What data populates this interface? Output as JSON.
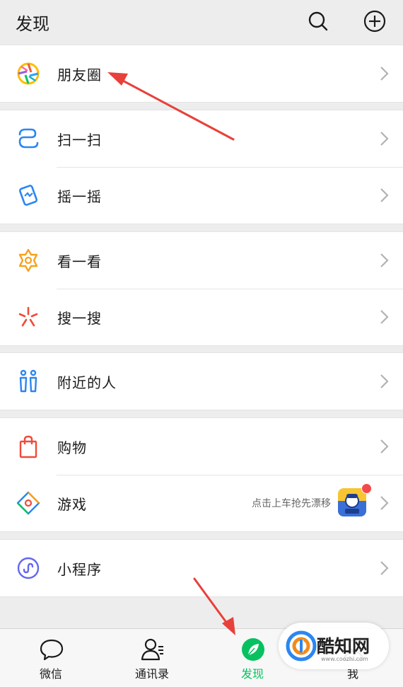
{
  "header": {
    "title": "发现",
    "search_icon": "search-icon",
    "add_icon": "plus-circle-icon"
  },
  "groups": [
    {
      "items": [
        {
          "label": "朋友圈",
          "icon": "moments-aperture-icon"
        }
      ]
    },
    {
      "items": [
        {
          "label": "扫一扫",
          "icon": "scan-icon"
        },
        {
          "label": "摇一摇",
          "icon": "shake-icon"
        }
      ]
    },
    {
      "items": [
        {
          "label": "看一看",
          "icon": "top-stories-icon"
        },
        {
          "label": "搜一搜",
          "icon": "search-sparkle-icon"
        }
      ]
    },
    {
      "items": [
        {
          "label": "附近的人",
          "icon": "people-nearby-icon"
        }
      ]
    },
    {
      "items": [
        {
          "label": "购物",
          "icon": "shopping-bag-icon"
        },
        {
          "label": "游戏",
          "icon": "game-diamond-icon",
          "hint": "点击上车抢先漂移"
        }
      ]
    },
    {
      "items": [
        {
          "label": "小程序",
          "icon": "mini-program-icon"
        }
      ]
    }
  ],
  "tabs": [
    {
      "label": "微信",
      "icon": "chat-bubble-icon"
    },
    {
      "label": "通讯录",
      "icon": "contacts-icon"
    },
    {
      "label": "发现",
      "icon": "compass-icon",
      "active": true
    },
    {
      "label": "我",
      "icon": "person-icon"
    }
  ],
  "watermark": {
    "text": "酷知网",
    "url": "www.coozhi.com"
  },
  "colors": {
    "accent": "#07c160",
    "arrow": "#e8403a",
    "background": "#ededed"
  }
}
